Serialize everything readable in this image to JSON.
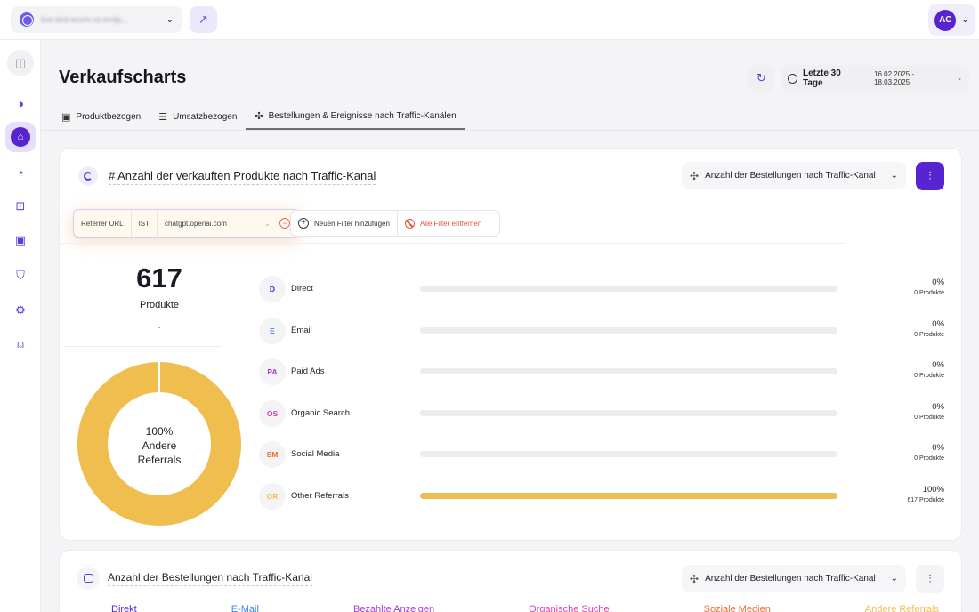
{
  "topbar": {
    "store_name": "live-test-ecom.xx-endp...",
    "avatar_initials": "AC"
  },
  "header": {
    "title": "Verkaufscharts",
    "date_range_label": "Letzte 30 Tage",
    "date_range": "16.02.2025 - 18.03.2025"
  },
  "tabs": [
    {
      "label": "Produktbezogen",
      "icon": "box-icon",
      "active": false
    },
    {
      "label": "Umsatzbezogen",
      "icon": "coins-icon",
      "active": false
    },
    {
      "label": "Bestellungen & Ereignisse nach Traffic-Kanälen",
      "icon": "nodes-icon",
      "active": true
    }
  ],
  "main_card": {
    "title": "# Anzahl der verkauften Produkte nach Traffic-Kanal",
    "metric_select": "Anzahl der Bestellungen nach Traffic-Kanal",
    "filter": {
      "field": "Referrer URL",
      "operator": "IST",
      "value": "chatgpt.openai.com"
    },
    "add_filter_label": "Neuen Filter hinzufügen",
    "clear_filters_label": "Alle Filter entfernen",
    "total": "617",
    "total_unit": "Produkte",
    "total_change": "-",
    "donut_label_pct": "100%",
    "donut_label_line1": "Andere",
    "donut_label_line2": "Referrals",
    "donut_share": 1.0,
    "donut_color": "#f0bd4f",
    "channels": [
      {
        "badge": "D",
        "label": "Direct",
        "pct": "0%",
        "count": "0 Produkte",
        "share": 0,
        "color": "#5624d0"
      },
      {
        "badge": "E",
        "label": "Email",
        "pct": "0%",
        "count": "0 Produkte",
        "share": 0,
        "color": "#3b82f6"
      },
      {
        "badge": "PA",
        "label": "Paid Ads",
        "pct": "0%",
        "count": "0 Produkte",
        "share": 0,
        "color": "#a23ccf"
      },
      {
        "badge": "OS",
        "label": "Organic Search",
        "pct": "0%",
        "count": "0 Produkte",
        "share": 0,
        "color": "#d63fae"
      },
      {
        "badge": "SM",
        "label": "Social Media",
        "pct": "0%",
        "count": "0 Produkte",
        "share": 0,
        "color": "#ef6a2a"
      },
      {
        "badge": "OR",
        "label": "Other Referrals",
        "pct": "100%",
        "count": "617 Produkte",
        "share": 1.0,
        "color": "#f0bd4f"
      }
    ]
  },
  "second_card": {
    "title": "Anzahl der Bestellungen nach Traffic-Kanal",
    "metric_select": "Anzahl der Bestellungen nach Traffic-Kanal",
    "legend": [
      {
        "label": "Direkt",
        "color": "#5624d0"
      },
      {
        "label": "E-Mail",
        "color": "#3b82f6"
      },
      {
        "label": "Bezahlte Anzeigen",
        "color": "#a23ccf"
      },
      {
        "label": "Organische Suche",
        "color": "#d63fae"
      },
      {
        "label": "Soziale Medien",
        "color": "#ef6a2a"
      },
      {
        "label": "Andere Referrals",
        "color": "#f0bd4f"
      }
    ]
  }
}
